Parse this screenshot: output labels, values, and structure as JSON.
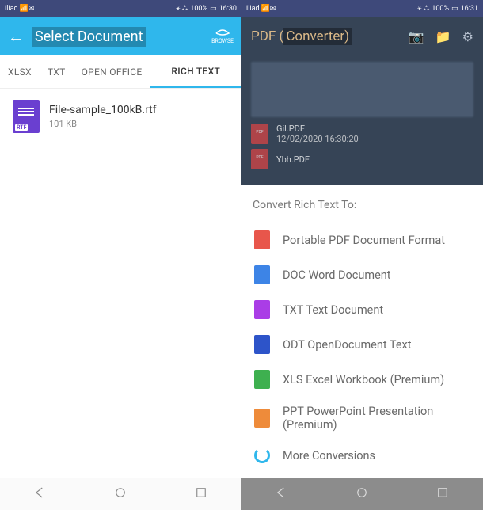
{
  "left": {
    "status": {
      "carrier": "iliad",
      "battery": "100%",
      "time": "16:30"
    },
    "appbar": {
      "title": "Select Document",
      "browse": "BROWSE"
    },
    "tabs": {
      "xls": "XLSX",
      "txt": "TXT",
      "open_office": "OPEN OFFICE",
      "rich": "RICH TEXT"
    },
    "file": {
      "name": "File-sample_100kB.rtf",
      "size": "101 KB",
      "badge": "RTF"
    }
  },
  "right": {
    "status": {
      "carrier": "iliad",
      "battery": "100%",
      "time": "16:31"
    },
    "appbar": {
      "brand_a": "PDF (",
      "brand_b": "Converter)"
    },
    "dim_files": [
      {
        "name": "Gil.PDF",
        "date": "12/02/2020 16:30:20"
      },
      {
        "name": "Ybh.PDF",
        "date": ""
      }
    ],
    "sheet": {
      "title": "Convert Rich Text To:",
      "opts": [
        {
          "label": "Portable PDF Document Format",
          "color": "red"
        },
        {
          "label": "DOC Word Document",
          "color": "blue"
        },
        {
          "label": "TXT Text Document",
          "color": "purple"
        },
        {
          "label": "ODT OpenDocument Text",
          "color": "dblue"
        },
        {
          "label": "XLS Excel Workbook (Premium)",
          "color": "green"
        },
        {
          "label": "PPT PowerPoint Presentation (Premium)",
          "color": "orange"
        },
        {
          "label": "More Conversions",
          "color": "sync"
        }
      ]
    }
  }
}
